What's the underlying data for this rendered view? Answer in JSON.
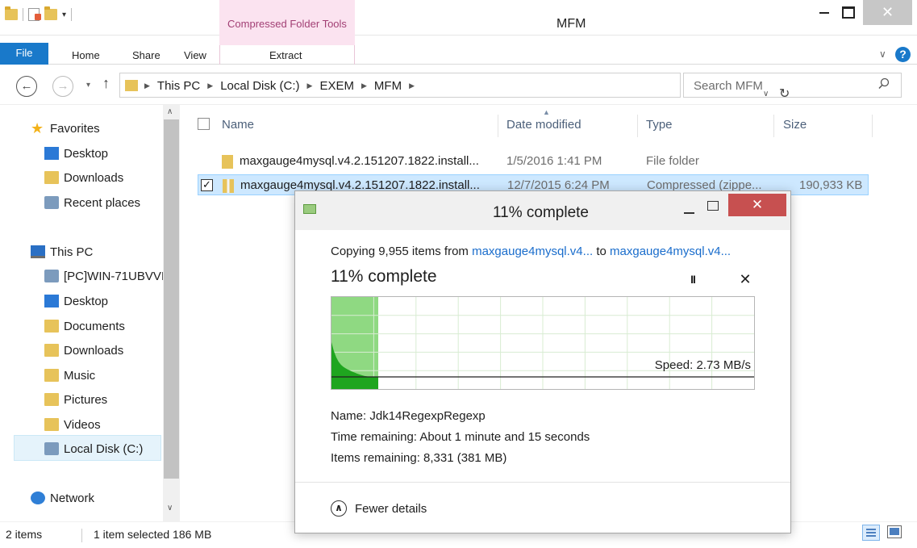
{
  "window": {
    "title": "MFM",
    "contextual_tab": "Compressed Folder Tools",
    "close_glyph": "✕"
  },
  "ribbon": {
    "tabs": [
      "File",
      "Home",
      "Share",
      "View",
      "Extract"
    ]
  },
  "address": {
    "crumbs": [
      "This PC",
      "Local Disk (C:)",
      "EXEM",
      "MFM"
    ],
    "search_placeholder": "Search MFM"
  },
  "nav": {
    "favorites": "Favorites",
    "favorites_items": [
      "Desktop",
      "Downloads",
      "Recent places"
    ],
    "this_pc": "This PC",
    "pc_items": [
      "[PC]WIN-71UBVVI",
      "Desktop",
      "Documents",
      "Downloads",
      "Music",
      "Pictures",
      "Videos",
      "Local Disk (C:)"
    ],
    "network": "Network"
  },
  "list": {
    "columns": [
      "Name",
      "Date modified",
      "Type",
      "Size"
    ],
    "rows": [
      {
        "name": "maxgauge4mysql.v4.2.151207.1822.install...",
        "date": "1/5/2016 1:41 PM",
        "type": "File folder",
        "size": ""
      },
      {
        "name": "maxgauge4mysql.v4.2.151207.1822.install...",
        "date": "12/7/2015 6:24 PM",
        "type": "Compressed (zippe...",
        "size": "190,933 KB"
      }
    ]
  },
  "status": {
    "items": "2 items",
    "selected": "1 item selected  186 MB"
  },
  "dialog": {
    "title": "11% complete",
    "copy_prefix": "Copying 9,955 items from ",
    "source": "maxgauge4mysql.v4...",
    "to": " to ",
    "dest": "maxgauge4mysql.v4...",
    "progress_label": "11% complete",
    "progress_fraction": 0.11,
    "pause_glyph": "II",
    "cancel_glyph": "✕",
    "speed": "Speed: 2.73 MB/s",
    "name_line": "Name: Jdk14RegexpRegexp",
    "time_line": "Time remaining: About 1 minute and 15 seconds",
    "items_line": "Items remaining: 8,331 (381 MB)",
    "fewer_details": "Fewer details",
    "accent_green": "#8fd982",
    "graph_green": "#1fa51f"
  }
}
